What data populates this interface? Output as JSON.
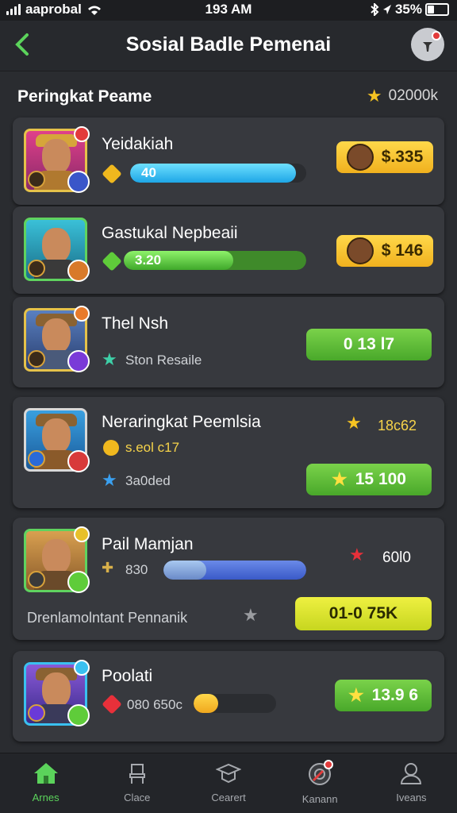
{
  "status": {
    "carrier": "aaprobal",
    "time": "193 AM",
    "battery": "35%"
  },
  "header": {
    "title": "Sosial Badle Pemenai"
  },
  "section": {
    "label": "Peringkat Peame",
    "total": "02000k"
  },
  "players": [
    {
      "name": "Yeidakiah",
      "bar_text": "40",
      "bar_fill": 0.94,
      "button": "$.335"
    },
    {
      "name": "Gastukal Nepbeaii",
      "bar_text": "3.20",
      "bar_fill": 0.6,
      "button": "$ 146"
    },
    {
      "name": "Thel Nsh",
      "stat": "Ston Resaile",
      "button": "0 13 l7"
    },
    {
      "name": "Neraringkat Peemlsia",
      "score": "18c62",
      "gem_text": "s.eol c17",
      "stat": "3a0ded",
      "button": "15 100"
    },
    {
      "name": "Pail Mamjan",
      "gem_text": "830",
      "bar_fill": 0.3,
      "score": "60l0",
      "stat": "Drenlamolntant Pennanik",
      "button": "01-0 75K"
    },
    {
      "name": "Poolati",
      "gem_text": "080 650c",
      "bar_fill": 0.3,
      "button": "13.9 6"
    }
  ],
  "nav": [
    {
      "label": "Arnes",
      "icon": "home-icon"
    },
    {
      "label": "Clace",
      "icon": "chair-icon"
    },
    {
      "label": "Cearert",
      "icon": "cap-icon"
    },
    {
      "label": "Kanann",
      "icon": "target-icon"
    },
    {
      "label": "Iveans",
      "icon": "user-icon"
    }
  ],
  "colors": {
    "accent": "#5bd35b",
    "blue_bar": "#3ac3f0",
    "green_bar": "#5fcc3a"
  }
}
